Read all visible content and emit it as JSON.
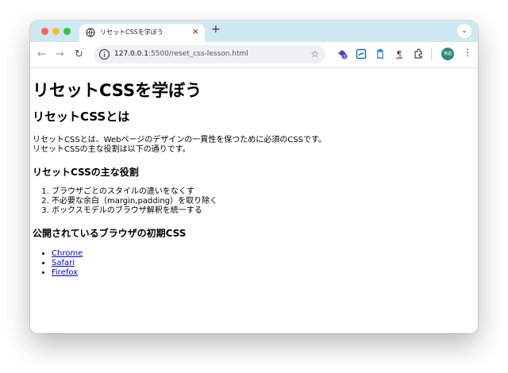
{
  "tab": {
    "title": "リセットCSSを学ぼう"
  },
  "address": {
    "host": "127.0.0.1",
    "path": ":5500/reset_css-lesson.html"
  },
  "profile": {
    "initials": "英語"
  },
  "page": {
    "h1": "リセットCSSを学ぼう",
    "h2": "リセットCSSとは",
    "para_line1": "リセットCSSとは、Webページのデザインの一貫性を保つために必須のCSSです。",
    "para_line2": "リセットCSSの主な役割は以下の通りです。",
    "roles_heading": "リセットCSSの主な役割",
    "roles": [
      "ブラウザごとのスタイルの違いをなくす",
      "不必要な余白（margin,padding）を取り除く",
      "ボックスモデルのブラウザ解釈を統一する"
    ],
    "browser_heading": "公開されているブラウザの初期CSS",
    "links": [
      "Chrome",
      "Safari",
      "Firefox"
    ]
  }
}
